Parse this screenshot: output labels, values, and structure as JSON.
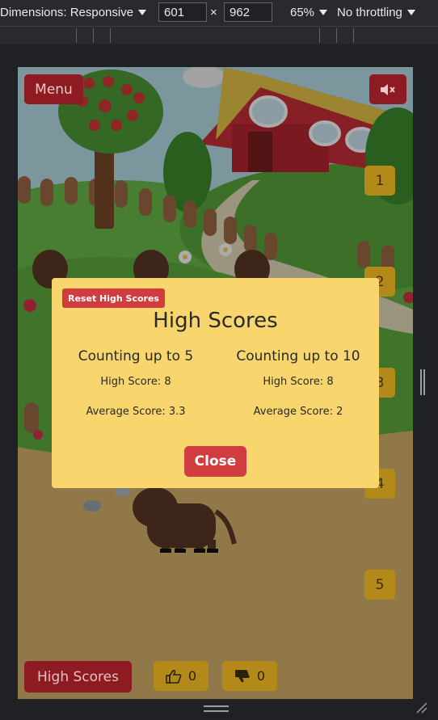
{
  "devtools": {
    "dimensions_label": "Dimensions: Responsive",
    "width_value": "601",
    "times": "×",
    "height_value": "962",
    "zoom": "65%",
    "throttling": "No throttling"
  },
  "game": {
    "menu_label": "Menu",
    "mute_icon": "mute-icon",
    "number_buttons": [
      "1",
      "2",
      "3",
      "4",
      "5"
    ],
    "high_scores_label": "High Scores",
    "thumbs_up_count": "0",
    "thumbs_down_count": "0"
  },
  "modal": {
    "reset_label": "Reset High Scores",
    "title": "High Scores",
    "columns": [
      {
        "title": "Counting up to 5",
        "high_score": "High Score: 8",
        "average_score": "Average Score: 3.3"
      },
      {
        "title": "Counting up to 10",
        "high_score": "High Score: 8",
        "average_score": "Average Score: 2"
      }
    ],
    "close_label": "Close"
  },
  "colors": {
    "modal_bg": "#f9d56e",
    "button_red": "#d13c40",
    "dark_red": "#8e1a22",
    "gold": "#b38a1a"
  }
}
